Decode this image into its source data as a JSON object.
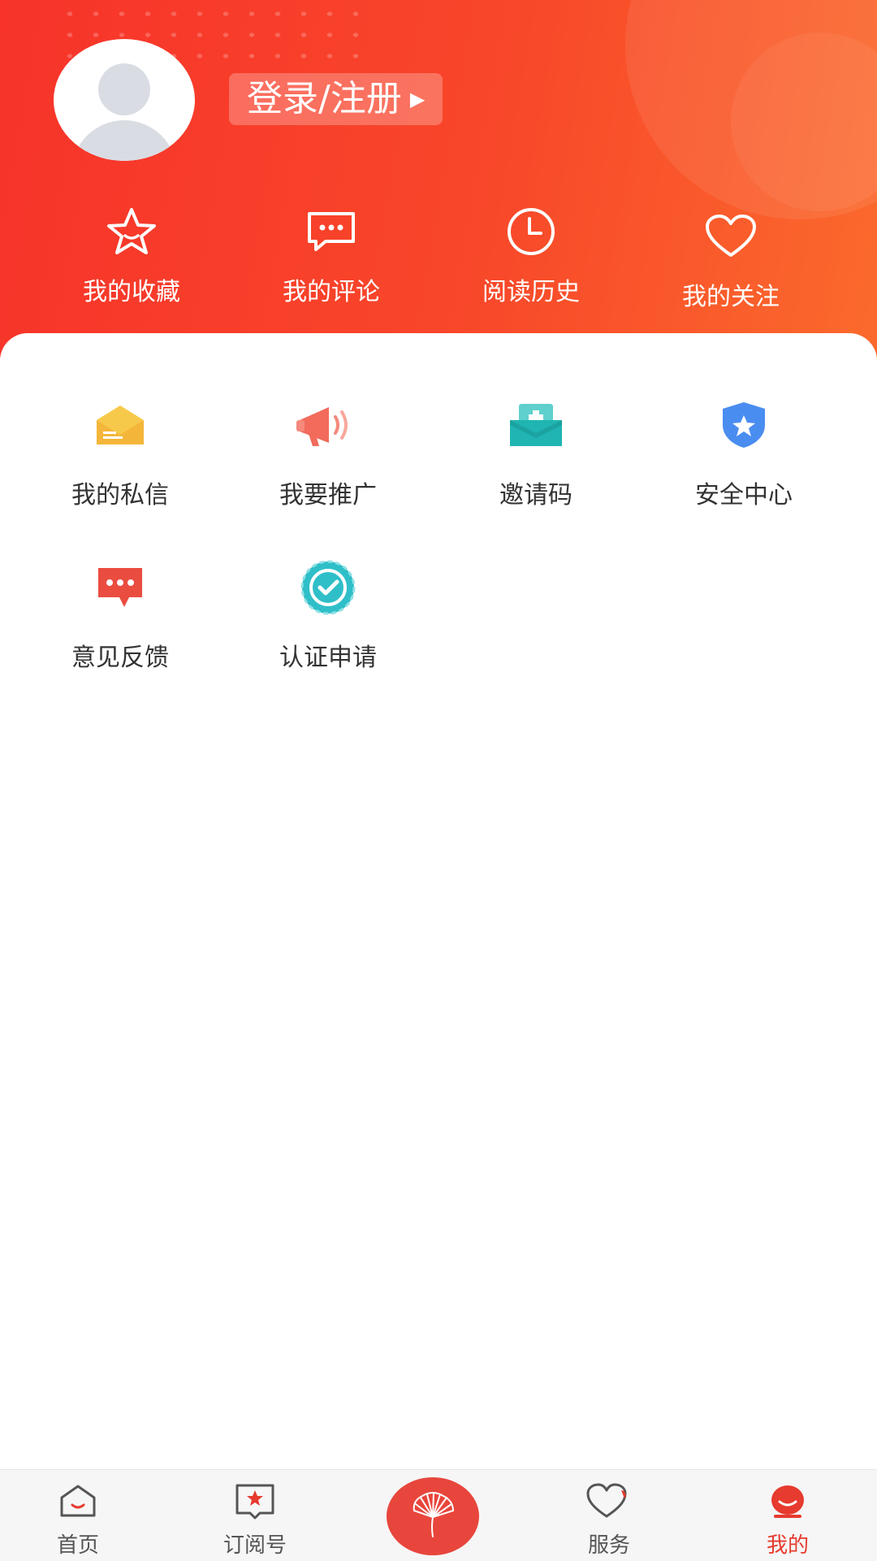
{
  "header": {
    "login_label": "登录/注册",
    "quick_links": [
      {
        "label": "我的收藏",
        "icon": "star-icon"
      },
      {
        "label": "我的评论",
        "icon": "comment-icon"
      },
      {
        "label": "阅读历史",
        "icon": "clock-icon"
      },
      {
        "label": "我的关注",
        "icon": "heart-icon"
      }
    ]
  },
  "grid": [
    {
      "label": "我的私信",
      "icon": "envelope-icon",
      "color": "#f4b63a"
    },
    {
      "label": "我要推广",
      "icon": "megaphone-icon",
      "color": "#f26b5b"
    },
    {
      "label": "邀请码",
      "icon": "invite-box-icon",
      "color": "#20b5b3"
    },
    {
      "label": "安全中心",
      "icon": "shield-star-icon",
      "color": "#4a8df0"
    },
    {
      "label": "意见反馈",
      "icon": "feedback-bubble-icon",
      "color": "#ea4c40"
    },
    {
      "label": "认证申请",
      "icon": "verified-badge-icon",
      "color": "#2fbfc8"
    }
  ],
  "tabbar": {
    "tabs": [
      {
        "label": "首页",
        "icon": "home-icon",
        "active": false
      },
      {
        "label": "订阅号",
        "icon": "subscription-icon",
        "active": false
      },
      {
        "label": "服务",
        "icon": "service-heart-icon",
        "active": false
      },
      {
        "label": "我的",
        "icon": "profile-icon",
        "active": true
      }
    ],
    "center_icon": "fan-logo-icon"
  },
  "colors": {
    "header_red": "#f7332a",
    "accent": "#e63b2e"
  }
}
